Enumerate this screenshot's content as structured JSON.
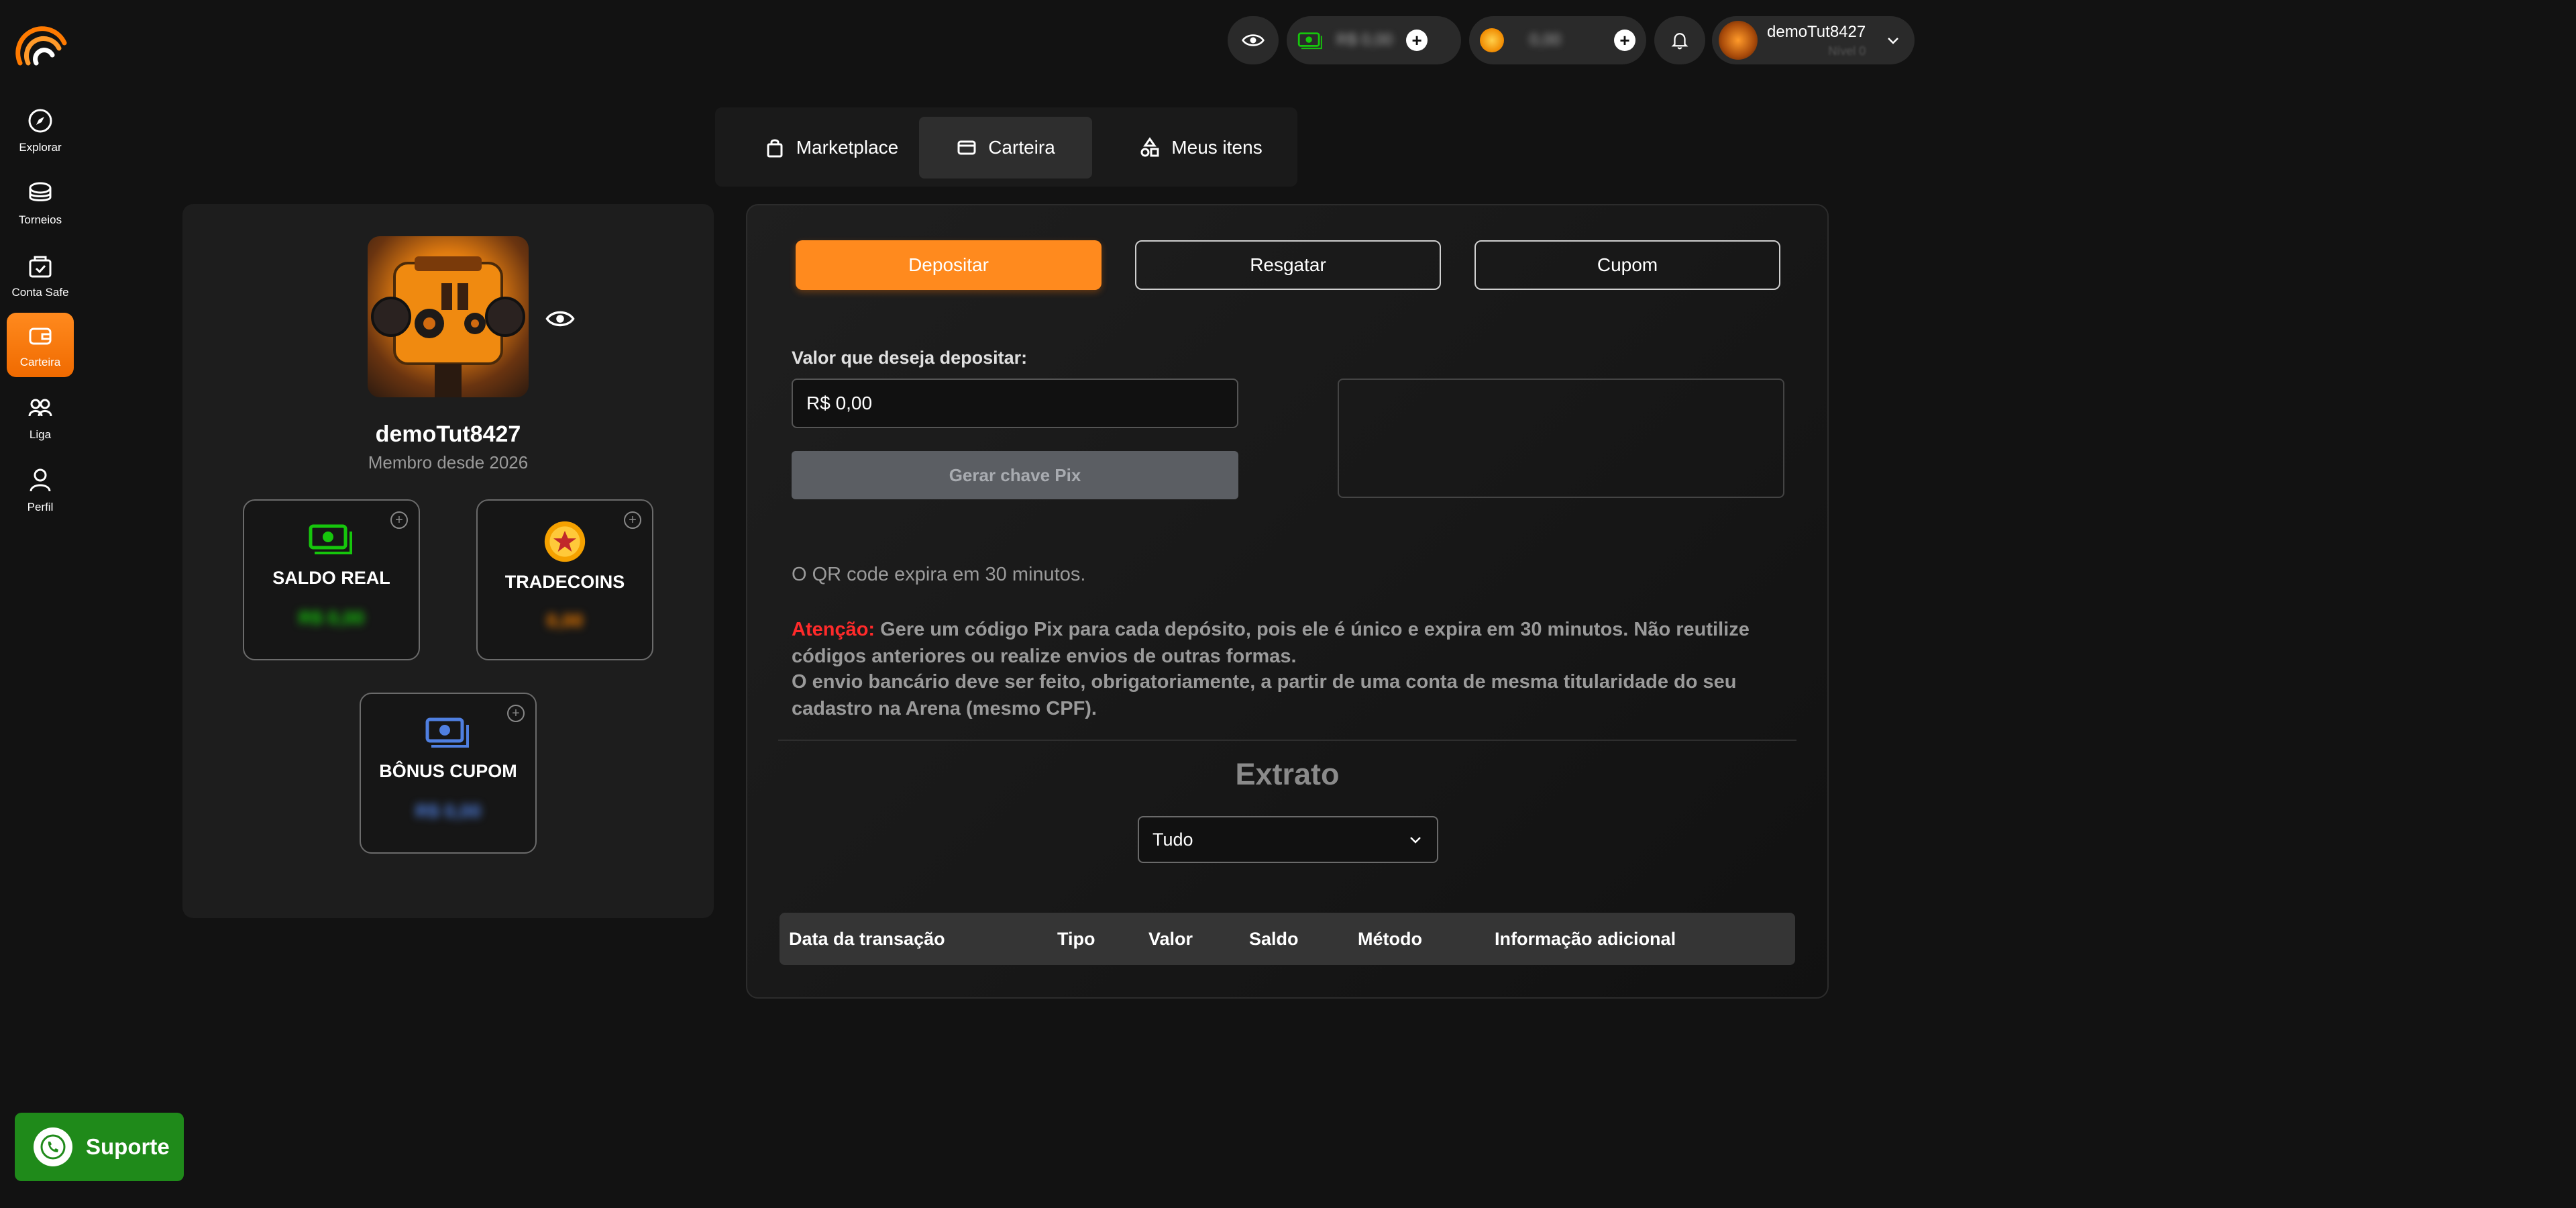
{
  "sidebar": {
    "items": [
      {
        "label": "Explorar",
        "icon": "compass-icon"
      },
      {
        "label": "Torneios",
        "icon": "trophy-icon"
      },
      {
        "label": "Conta Safe",
        "icon": "safe-icon"
      },
      {
        "label": "Carteira",
        "icon": "wallet-icon",
        "active": true
      },
      {
        "label": "Liga",
        "icon": "group-icon"
      },
      {
        "label": "Perfil",
        "icon": "user-icon"
      }
    ]
  },
  "support": {
    "label": "Suporte"
  },
  "topbar": {
    "real_balance": "R$ 0,00",
    "coin_balance": "0,00",
    "username": "demoTut8427",
    "level": "Nível 0"
  },
  "tabs": [
    {
      "label": "Marketplace"
    },
    {
      "label": "Carteira",
      "active": true
    },
    {
      "label": "Meus itens"
    }
  ],
  "profile": {
    "username": "demoTut8427",
    "member_since": "Membro desde 2026",
    "cards": [
      {
        "title": "SALDO REAL",
        "value": "R$ 0,00",
        "color": "#16c60c"
      },
      {
        "title": "TRADECOINS",
        "value": "0,00",
        "color": "#f07d00"
      },
      {
        "title": "BÔNUS CUPOM",
        "value": "R$ 0,00",
        "color": "#4f7fe0"
      }
    ]
  },
  "actions": {
    "deposit": "Depositar",
    "withdraw": "Resgatar",
    "coupon": "Cupom"
  },
  "deposit": {
    "label": "Valor que deseja depositar:",
    "amount": "R$ 0,00",
    "generate": "Gerar chave Pix",
    "qr_expiry": "O QR code expira em 30 minutos.",
    "warning_label": "Atenção:",
    "warning_text": "Gere um código Pix para cada depósito, pois ele é único e expira em 30 minutos. Não reutilize códigos anteriores ou realize envios de outras formas.",
    "warning_text2": "O envio bancário deve ser feito, obrigatoriamente, a partir de uma conta de mesma titularidade do seu cadastro na Arena (mesmo CPF)."
  },
  "statement": {
    "title": "Extrato",
    "filter": "Tudo",
    "columns": [
      "Data da transação",
      "Tipo",
      "Valor",
      "Saldo",
      "Método",
      "Informação adicional"
    ]
  },
  "colors": {
    "accent": "#ff8a1e",
    "background": "#121212",
    "warning": "#ff2a2a",
    "support": "#1f8a1a"
  }
}
